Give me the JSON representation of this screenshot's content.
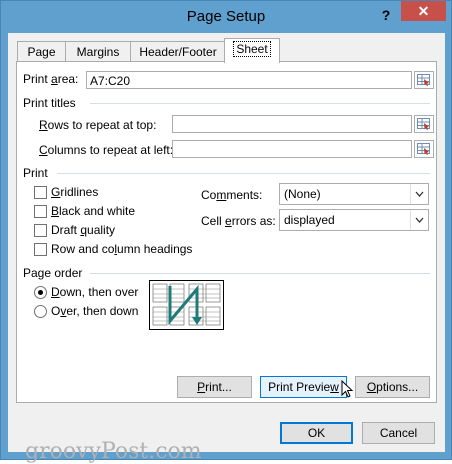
{
  "window": {
    "title": "Page Setup",
    "help_label": "?",
    "close_label": "✕"
  },
  "tabs": [
    {
      "label": "Page"
    },
    {
      "label": "Margins"
    },
    {
      "label": "Header/Footer"
    },
    {
      "label": "Sheet",
      "active": true
    }
  ],
  "print_area": {
    "label_pre": "Print ",
    "label_u": "a",
    "label_post": "rea:",
    "value": "A7:C20"
  },
  "print_titles": {
    "heading": "Print titles",
    "rows_label_u": "R",
    "rows_label_post": "ows to repeat at top:",
    "rows_value": "",
    "cols_label_u": "C",
    "cols_label_post": "olumns to repeat at left:",
    "cols_value": ""
  },
  "print": {
    "heading": "Print",
    "options": [
      {
        "u": "G",
        "post": "ridlines",
        "checked": false
      },
      {
        "u": "B",
        "post": "lack and white",
        "checked": false
      },
      {
        "pre": "Draft ",
        "u": "q",
        "post": "uality",
        "checked": false
      },
      {
        "pre": "Row and co",
        "u": "l",
        "post": "umn headings",
        "checked": false
      }
    ],
    "comments_label_pre": "Co",
    "comments_label_u": "m",
    "comments_label_post": "ments:",
    "comments_value": "(None)",
    "errors_label_pre": "Cell ",
    "errors_label_u": "e",
    "errors_label_post": "rrors as:",
    "errors_value": "displayed"
  },
  "page_order": {
    "heading": "Page order",
    "down_u": "D",
    "down_post": "own, then over",
    "down_selected": true,
    "over_pre": "O",
    "over_u": "v",
    "over_post": "er, then down",
    "over_selected": false
  },
  "buttons": {
    "print_pre": "",
    "print_u": "P",
    "print_post": "rint...",
    "preview_pre": "Print Previe",
    "preview_u": "w",
    "preview_post": "",
    "options_pre": "",
    "options_u": "O",
    "options_post": "ptions...",
    "ok": "OK",
    "cancel": "Cancel"
  },
  "watermark": "groovyPost.com",
  "colors": {
    "titlebar": "#5fa0cf",
    "close": "#c7504a",
    "accent": "#0078d7",
    "diagram_arrow": "#1f7a7a"
  }
}
